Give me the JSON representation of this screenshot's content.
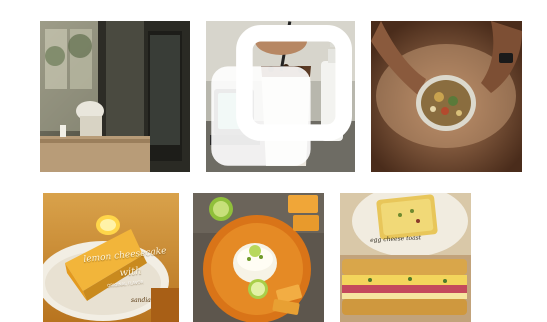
{
  "gallery": {
    "posts": [
      {
        "id": "cafe-interior",
        "icon": "photo-thumbnail",
        "multi": false
      },
      {
        "id": "milk-drink",
        "icon": "photo-thumbnail",
        "multi": true
      },
      {
        "id": "bowl-in-hands",
        "icon": "photo-thumbnail",
        "multi": false
      },
      {
        "id": "lemon-cheesecake",
        "icon": "photo-thumbnail",
        "multi": false,
        "title": "lemon cheesecake",
        "with_text": "with",
        "subtitle": "ORIGINAL FLAVOR",
        "brand": "sandia"
      },
      {
        "id": "lime-dessert-tray",
        "icon": "photo-thumbnail",
        "multi": false
      },
      {
        "id": "toast-sandwich",
        "icon": "photo-thumbnail",
        "multi": false,
        "caption": "egg cheese toast"
      }
    ]
  },
  "colors": {
    "background": "#ffffff",
    "warm_orange": "#e08a1f",
    "cheesecake_yellow": "#f2b53a",
    "lime_green": "#8fbf3a"
  }
}
